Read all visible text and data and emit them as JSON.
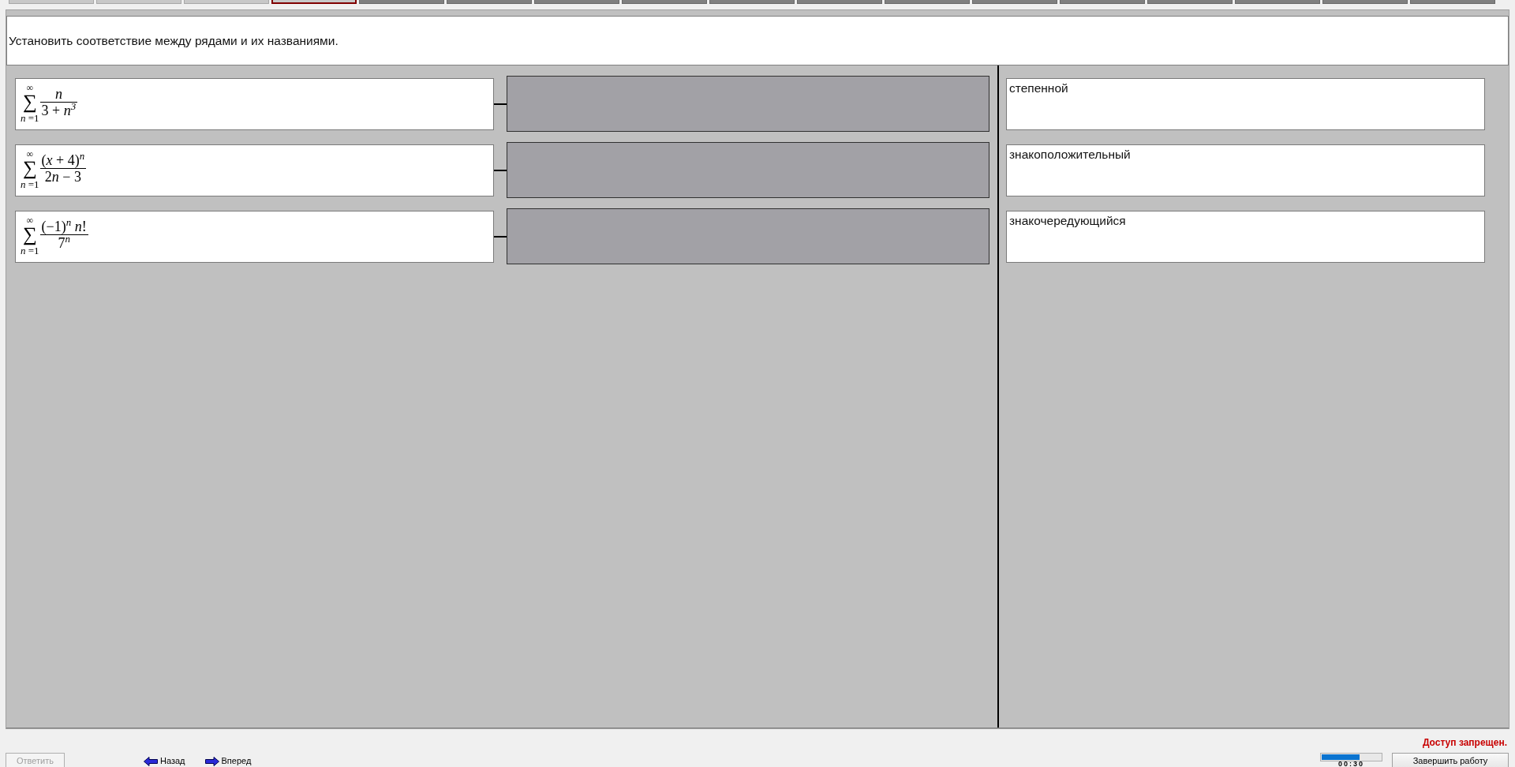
{
  "question_tabs": [
    {
      "selected": false,
      "visited": true
    },
    {
      "selected": false,
      "visited": true
    },
    {
      "selected": false,
      "visited": true
    },
    {
      "selected": true,
      "visited": true
    },
    {
      "selected": false,
      "visited": false
    },
    {
      "selected": false,
      "visited": false
    },
    {
      "selected": false,
      "visited": false
    },
    {
      "selected": false,
      "visited": false
    },
    {
      "selected": false,
      "visited": false
    },
    {
      "selected": false,
      "visited": false
    },
    {
      "selected": false,
      "visited": false
    },
    {
      "selected": false,
      "visited": false
    },
    {
      "selected": false,
      "visited": false
    },
    {
      "selected": false,
      "visited": false
    },
    {
      "selected": false,
      "visited": false
    },
    {
      "selected": false,
      "visited": false
    },
    {
      "selected": false,
      "visited": false
    }
  ],
  "question": "Установить соответствие между рядами и их названиями.",
  "series": [
    {
      "operator": "∑",
      "upper": "∞",
      "lower": "*n* =1",
      "numerator": "*n*",
      "denominator": "3 + *n*$^{3}$"
    },
    {
      "operator": "∑",
      "upper": "∞",
      "lower": "*n* =1",
      "numerator": "(*x* + 4)$^{n}$",
      "denominator": "2⁢*n* − 3"
    },
    {
      "operator": "∑",
      "upper": "∞",
      "lower": "*n* =1",
      "numerator": "(−1)$^{n}$ *n*!",
      "denominator": "7$^{n}$"
    }
  ],
  "answer_options": [
    "степенной",
    "знакоположительный",
    "знакочередующийся"
  ],
  "bottom_bar": {
    "answer_button": {
      "label": "Ответить",
      "disabled": true
    },
    "back_link": "Назад",
    "forward_link": "Вперед",
    "status": "Доступ запрещен.",
    "timer": {
      "level": 0.64,
      "reading": "00:30"
    },
    "finish_button": "Завершить работу"
  }
}
